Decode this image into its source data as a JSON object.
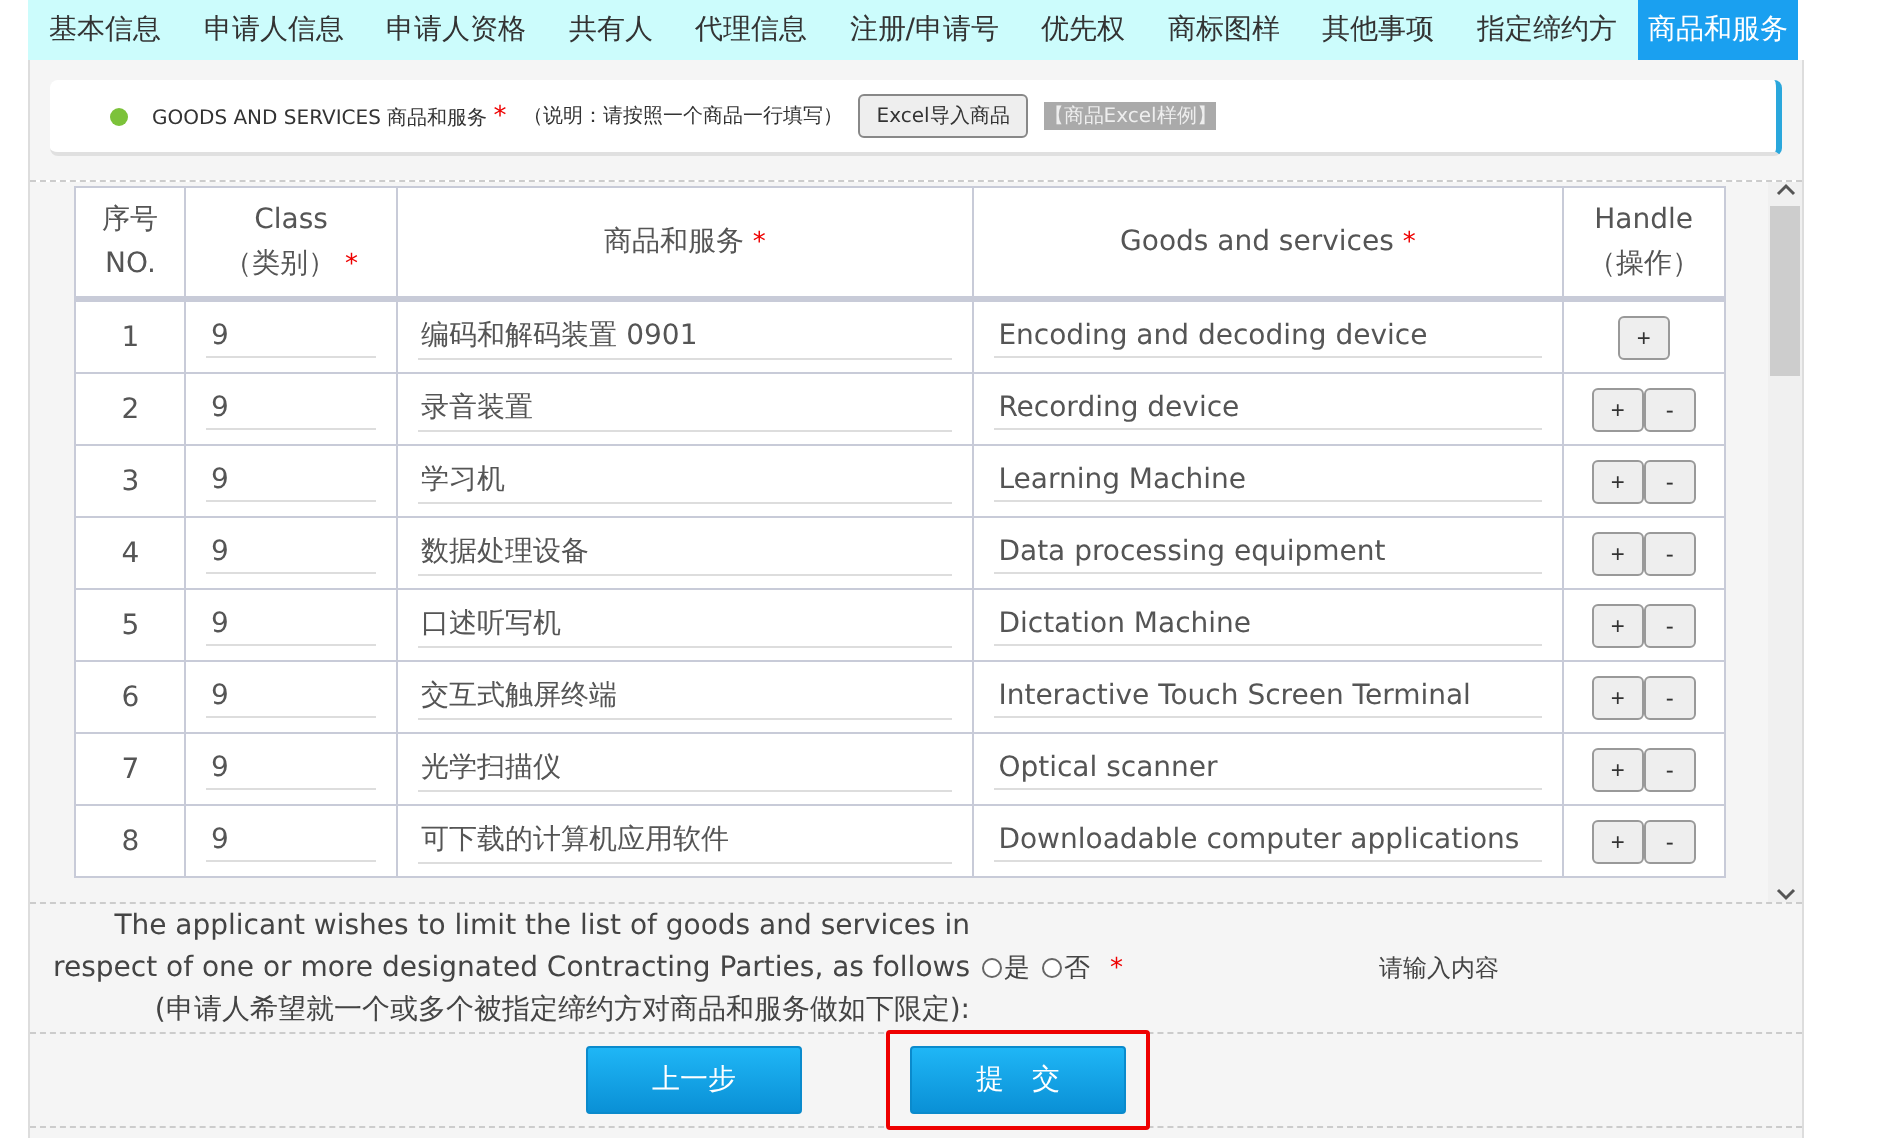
{
  "tabs": [
    {
      "label": "基本信息",
      "selected": false
    },
    {
      "label": "申请人信息",
      "selected": false
    },
    {
      "label": "申请人资格",
      "selected": false
    },
    {
      "label": "共有人",
      "selected": false
    },
    {
      "label": "代理信息",
      "selected": false
    },
    {
      "label": "注册/申请号",
      "selected": false
    },
    {
      "label": "优先权",
      "selected": false
    },
    {
      "label": "商标图样",
      "selected": false
    },
    {
      "label": "其他事项",
      "selected": false
    },
    {
      "label": "指定缔约方",
      "selected": false
    },
    {
      "label": "商品和服务",
      "selected": true
    }
  ],
  "section": {
    "title": "GOODS AND SERVICES 商品和服务",
    "required": "*",
    "note": "（说明：请按照一个商品一行填写）",
    "import_button": "Excel导入商品",
    "sample_link": "【商品Excel样例】"
  },
  "table": {
    "columns": [
      {
        "label": "序号",
        "sub": "NO."
      },
      {
        "label": "Class",
        "sub": "（类别）",
        "required": "*"
      },
      {
        "label": "商品和服务",
        "required": "*"
      },
      {
        "label": "Goods and services",
        "required": "*"
      },
      {
        "label": "Handle",
        "sub": "（操作）"
      }
    ],
    "rows": [
      {
        "no": "1",
        "class": "9",
        "cn": "编码和解码装置 0901",
        "en": "Encoding and decoding device",
        "actions": [
          "+"
        ]
      },
      {
        "no": "2",
        "class": "9",
        "cn": "录音装置",
        "en": "Recording device",
        "actions": [
          "+",
          "-"
        ]
      },
      {
        "no": "3",
        "class": "9",
        "cn": "学习机",
        "en": "Learning Machine",
        "actions": [
          "+",
          "-"
        ]
      },
      {
        "no": "4",
        "class": "9",
        "cn": "数据处理设备",
        "en": "Data processing equipment",
        "actions": [
          "+",
          "-"
        ]
      },
      {
        "no": "5",
        "class": "9",
        "cn": "口述听写机",
        "en": "Dictation Machine",
        "actions": [
          "+",
          "-"
        ]
      },
      {
        "no": "6",
        "class": "9",
        "cn": "交互式触屏终端",
        "en": "Interactive Touch Screen Terminal",
        "actions": [
          "+",
          "-"
        ]
      },
      {
        "no": "7",
        "class": "9",
        "cn": "光学扫描仪",
        "en": "Optical scanner",
        "actions": [
          "+",
          "-"
        ]
      },
      {
        "no": "8",
        "class": "9",
        "cn": "可下载的计算机应用软件",
        "en": "Downloadable computer applications",
        "actions": [
          "+",
          "-"
        ]
      }
    ]
  },
  "limit": {
    "line1": "The applicant wishes to limit the list of goods and services in",
    "line2": "respect of one or more designated Contracting Parties, as follows",
    "line3": "(申请人希望就一个或多个被指定缔约方对商品和服务做如下限定):",
    "options": [
      {
        "label": "是",
        "selected": false
      },
      {
        "label": "否",
        "selected": false
      }
    ],
    "required": "*",
    "placeholder": "请输入内容"
  },
  "buttons": [
    {
      "label": "上一步",
      "highlighted": false
    },
    {
      "label": "提　交",
      "highlighted": true
    }
  ]
}
